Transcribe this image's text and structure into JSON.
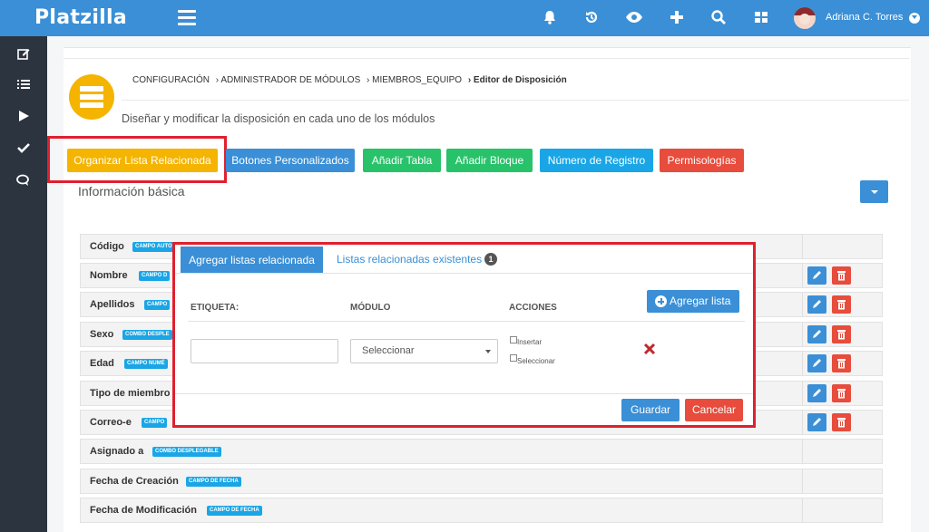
{
  "app": {
    "brand": "Platzilla",
    "user_name": "Adriana C. Torres"
  },
  "topbar_icons": [
    "bell-icon",
    "history-icon",
    "eye-icon",
    "plus-icon",
    "search-icon",
    "grid-icon"
  ],
  "sidebar_icons": [
    "edit-icon",
    "list-icon",
    "play-icon",
    "check-icon",
    "chat-icon"
  ],
  "breadcrumb": {
    "items": [
      "CONFIGURACIÓN",
      "› ADMINISTRADOR DE MÓDULOS",
      "› MIEMBROS_EQUIPO",
      "› Editor de Disposición"
    ]
  },
  "page": {
    "subtitle": "Diseñar y modificar la disposición en cada uno de los módulos"
  },
  "actions": {
    "organize": "Organizar Lista Relacionada",
    "custom_buttons": "Botones Personalizados",
    "add_table": "Añadir Tabla",
    "add_block": "Añadir Bloque",
    "record_number": "Número de Registro",
    "permissions": "Permisologías"
  },
  "section": {
    "title": "Información básica"
  },
  "fields": [
    {
      "label": "Código",
      "tag": "CAMPO AUTO"
    },
    {
      "label": "Nombre",
      "tag": "CAMPO D"
    },
    {
      "label": "Apellidos",
      "tag": "CAMPO"
    },
    {
      "label": "Sexo",
      "tag": "COMBO DESPLE"
    },
    {
      "label": "Edad",
      "tag": "CAMPO NUMÉ"
    },
    {
      "label": "Tipo de miembro",
      "tag": ""
    },
    {
      "label": "Correo-e",
      "tag": "CAMPO"
    },
    {
      "label": "Asignado a",
      "tag": "COMBO DESPLEGABLE"
    },
    {
      "label": "Fecha de Creación",
      "tag": "CAMPO DE FECHA"
    },
    {
      "label": "Fecha de Modificación",
      "tag": "CAMPO DE FECHA"
    }
  ],
  "modal": {
    "tab_add": "Agregar listas relacionada",
    "tab_existing": "Listas relacionadas existentes",
    "existing_count": "1",
    "col_label": "ETIQUETA:",
    "col_module": "MÓDULO",
    "col_actions": "ACCIONES",
    "add_list_button": "Agregar lista",
    "label_value": "",
    "module_selected": "Seleccionar",
    "check_insert": "Insertar",
    "check_select": "Seleccionar",
    "save": "Guardar",
    "cancel": "Cancelar"
  },
  "colors": {
    "primary": "#3a8fd6",
    "warning": "#f4b400",
    "success": "#28c26a",
    "info": "#1aa6e6",
    "danger": "#e74c3c",
    "highlight": "#e0202e"
  }
}
